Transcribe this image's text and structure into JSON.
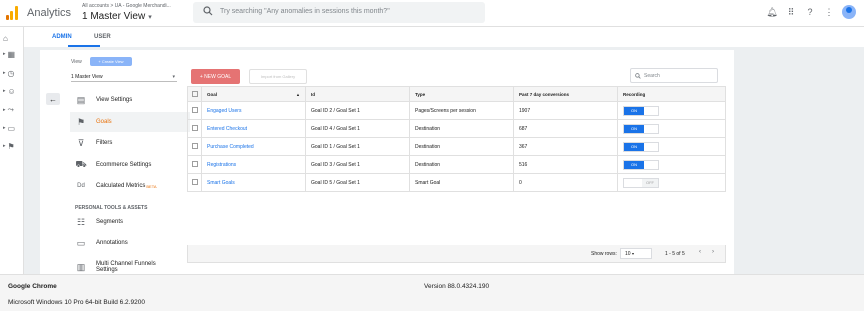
{
  "header": {
    "app_title": "Analytics",
    "breadcrumb": "All accounts > UA - Google Merchandi...",
    "view_name": "1 Master View",
    "view_caret": "▾",
    "search_placeholder": "Try searching \"Any anomalies in sessions this month?\"",
    "icons": [
      "bell-icon",
      "apps-icon",
      "help-icon",
      "more-vert-icon",
      "account-icon"
    ]
  },
  "rail": {
    "icons": [
      "home-icon",
      "customization-icon",
      "reports-icon",
      "audience-icon",
      "acquisition-icon",
      "behavior-icon",
      "conversions-icon"
    ]
  },
  "tabs": [
    "ADMIN",
    "USER"
  ],
  "view_panel": {
    "label": "View",
    "create_view": "+ Create View",
    "selected_view": "1 Master View",
    "back_icon": "←",
    "nav": [
      {
        "label": "View Settings",
        "icon": "document-icon",
        "glyph": "▤"
      },
      {
        "label": "Goals",
        "icon": "flag-icon",
        "glyph": "⚑",
        "active": true
      },
      {
        "label": "Filters",
        "icon": "filter-icon",
        "glyph": "⊽"
      },
      {
        "label": "Ecommerce Settings",
        "icon": "cart-icon",
        "glyph": "⛟"
      },
      {
        "label": "Calculated Metrics",
        "icon": "calculated-metrics-icon",
        "glyph": "Dd",
        "badge": "BETA"
      }
    ],
    "section_title": "PERSONAL TOOLS & ASSETS",
    "tools": [
      {
        "label": "Segments",
        "icon": "segments-icon",
        "glyph": "☷"
      },
      {
        "label": "Annotations",
        "icon": "annotations-icon",
        "glyph": "▭"
      },
      {
        "label": "Multi Channel Funnels Settings",
        "icon": "funnels-icon",
        "glyph": "▥"
      }
    ]
  },
  "goals": {
    "new_goal": "+ NEW GOAL",
    "import": "Import from Gallery",
    "search_placeholder": "Search",
    "columns": [
      "Goal",
      "Id",
      "Type",
      "Past 7 day conversions",
      "Recording"
    ],
    "rows": [
      {
        "goal": "Engaged Users",
        "id": "Goal ID 2 / Goal Set 1",
        "type": "Pages/Screens per session",
        "conversions": "1907",
        "recording": "ON"
      },
      {
        "goal": "Entered Checkout",
        "id": "Goal ID 4 / Goal Set 1",
        "type": "Destination",
        "conversions": "687",
        "recording": "ON"
      },
      {
        "goal": "Purchase Completed",
        "id": "Goal ID 1 / Goal Set 1",
        "type": "Destination",
        "conversions": "367",
        "recording": "ON"
      },
      {
        "goal": "Registrations",
        "id": "Goal ID 3 / Goal Set 1",
        "type": "Destination",
        "conversions": "516",
        "recording": "ON"
      },
      {
        "goal": "Smart Goals",
        "id": "Goal ID 5 / Goal Set 1",
        "type": "Smart Goal",
        "conversions": "0",
        "recording": "OFF"
      }
    ],
    "show_rows_label": "Show rows:",
    "show_rows_value": "10",
    "range": "1 - 5 of 5"
  },
  "system": {
    "app": "Google Chrome",
    "version": "Version 88.0.4324.190",
    "os": "Microsoft Windows 10 Pro 64-bit Build 6.2.9200"
  },
  "colors": {
    "accent": "#1a73e8",
    "new_goal": "#e57373",
    "active_nav": "#e8710a"
  }
}
